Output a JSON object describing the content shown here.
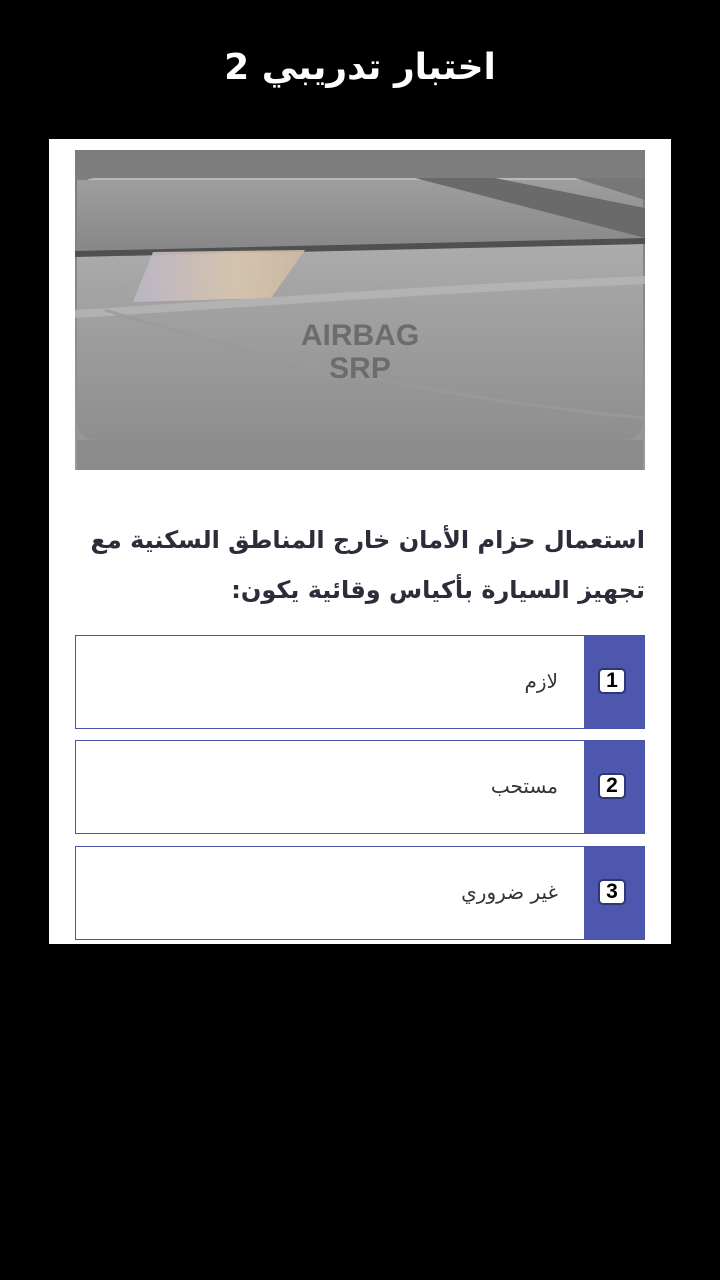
{
  "header": {
    "title": "اختبار تدريبي 2"
  },
  "image": {
    "label_line1": "AIRBAG",
    "label_line2": "SRP"
  },
  "question": {
    "line1": "استعمال حزام الأمان خارج المناطق السكنية مع",
    "line2": "تجهيز السيارة بأكياس وقائية يكون:"
  },
  "options": [
    {
      "number": "1",
      "text": "لازم"
    },
    {
      "number": "2",
      "text": "مستحب"
    },
    {
      "number": "3",
      "text": "غير ضروري"
    }
  ],
  "colors": {
    "background": "#000000",
    "card": "#ffffff",
    "accent": "#4c57ad",
    "question_text": "#2b2d3a"
  }
}
